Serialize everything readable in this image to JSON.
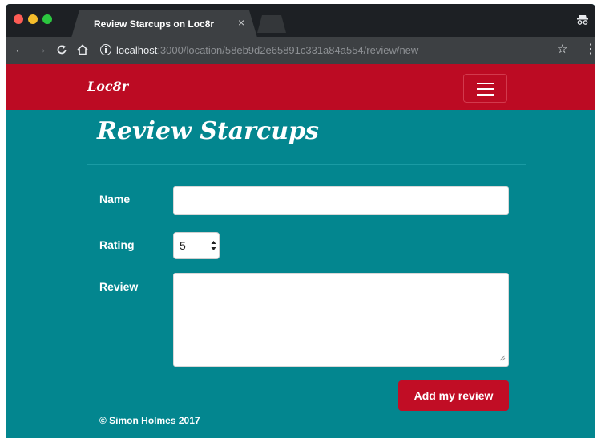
{
  "browser": {
    "tab_title": "Review Starcups on Loc8r",
    "tab_close": "×",
    "url_host": "localhost",
    "url_path": ":3000/location/58eb9d2e65891c331a84a554/review/new",
    "icons": {
      "back": "arrow-left-icon",
      "forward": "arrow-right-icon",
      "reload": "reload-icon",
      "home": "home-icon",
      "info": "info-icon",
      "bookmark": "star-icon",
      "menu": "kebab-menu-icon",
      "incognito": "incognito-icon"
    }
  },
  "navbar": {
    "brand": "Loc8r",
    "toggle_icon": "hamburger-icon"
  },
  "page": {
    "title": "Review Starcups"
  },
  "form": {
    "name_label": "Name",
    "name_value": "",
    "rating_label": "Rating",
    "rating_value": "5",
    "review_label": "Review",
    "review_value": "",
    "submit_label": "Add my review"
  },
  "footer": {
    "text": "© Simon Holmes 2017"
  },
  "colors": {
    "navbar": "#bc0b23",
    "page_background": "#03868f",
    "button": "#c10d25",
    "browser_chrome": "#1d2024"
  }
}
